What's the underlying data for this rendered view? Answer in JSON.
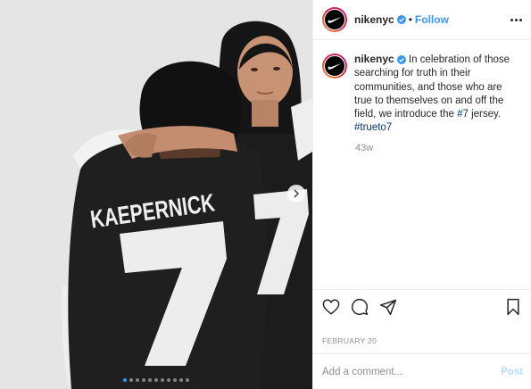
{
  "post": {
    "username": "nikenyc",
    "separator": "•",
    "follow_label": "Follow",
    "caption_body": " In celebration of those searching for truth in their communities, and those who are true to themselves on and off the field, we introduce the ",
    "caption_tag_1": "#7",
    "caption_after_tag": " jersey.",
    "caption_tag_2": "#trueto7",
    "age": "43w",
    "date": "FEBRUARY 20",
    "comment_placeholder": "Add a comment...",
    "post_label": "Post",
    "carousel_count": 11,
    "carousel_active_index": 0
  },
  "photo": {
    "jersey_name": "KAEPERNICK",
    "jersey_number": "7"
  },
  "icons": {
    "logo": "nike-swoosh-icon",
    "verified": "verified-badge-icon",
    "more": "more-options-icon",
    "like": "heart-icon",
    "comment": "comment-icon",
    "share": "share-icon",
    "save": "bookmark-icon",
    "next": "chevron-right-icon"
  },
  "colors": {
    "link_blue": "#3897f0",
    "hashtag": "#00376b",
    "muted": "#8e8e8e",
    "text": "#262626",
    "post_disabled": "#b2dffc"
  }
}
